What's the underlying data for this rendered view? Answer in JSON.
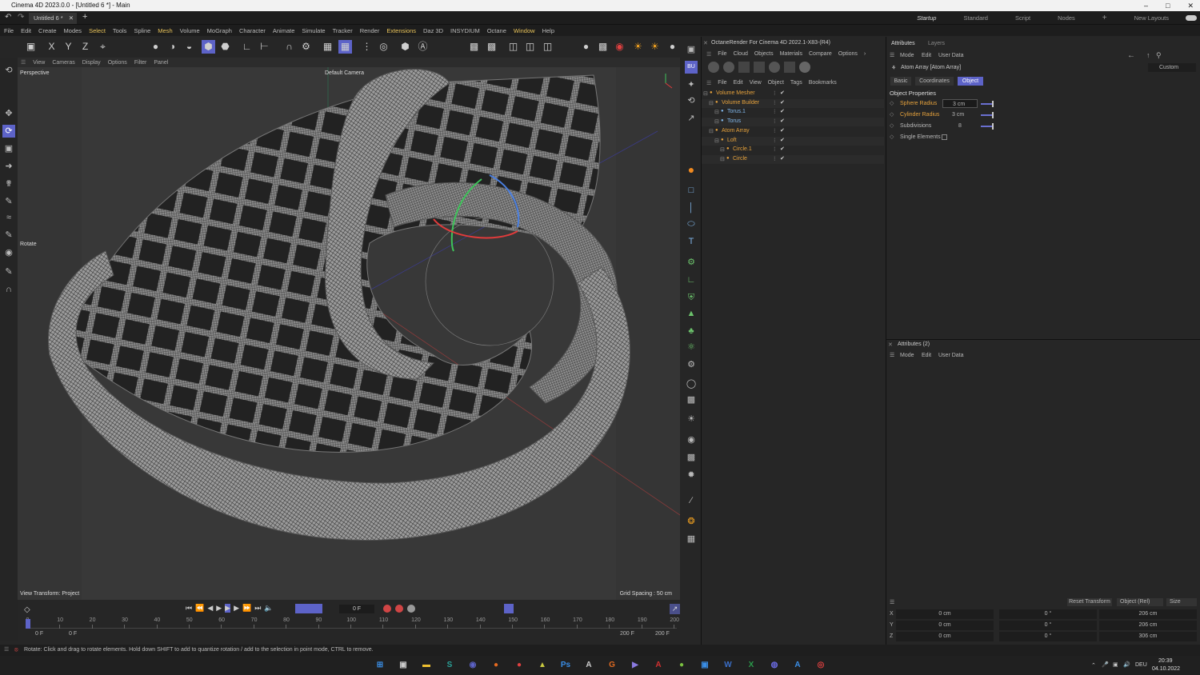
{
  "window": {
    "title": "Cinema 4D 2023.0.0 - [Untitled 6 *] - Main",
    "doc_tab": "Untitled 6 *"
  },
  "layouts": [
    "Startup",
    "Standard",
    "Script",
    "Nodes",
    "+",
    "New Layouts"
  ],
  "menu": [
    "File",
    "Edit",
    "Create",
    "Modes",
    "Select",
    "Tools",
    "Spline",
    "Mesh",
    "Volume",
    "MoGraph",
    "Character",
    "Animate",
    "Simulate",
    "Tracker",
    "Render",
    "Extensions",
    "Daz 3D",
    "INSYDIUM",
    "Octane",
    "Window",
    "Help"
  ],
  "viewport": {
    "menu": [
      "View",
      "Cameras",
      "Display",
      "Options",
      "Filter",
      "Panel"
    ],
    "name": "Perspective",
    "camera": "Default Camera",
    "tool": "Rotate",
    "transform": "View Transform: Project",
    "grid": "Grid Spacing : 50 cm"
  },
  "timeline": {
    "ticks": [
      "0",
      "10",
      "20",
      "30",
      "40",
      "50",
      "60",
      "70",
      "80",
      "90",
      "100",
      "110",
      "120",
      "130",
      "140",
      "150",
      "160",
      "170",
      "180",
      "190",
      "200"
    ],
    "current": "0 F",
    "start": "0 F",
    "start2": "0 F",
    "end": "200 F",
    "end2": "200 F"
  },
  "status": "Rotate: Click and drag to rotate elements. Hold down SHIFT to add to quantize rotation / add to the selection in point mode, CTRL to remove.",
  "octane": {
    "title": "OctaneRender For Cinema 4D 2022.1-X83-(R4)",
    "menu": [
      "File",
      "Cloud",
      "Objects",
      "Materials",
      "Compare",
      "Options"
    ]
  },
  "objects": {
    "menu": [
      "File",
      "Edit",
      "View",
      "Object",
      "Tags",
      "Bookmarks"
    ],
    "tree": [
      {
        "name": "Volume Mesher",
        "indent": 0,
        "color": "#e6a23c"
      },
      {
        "name": "Volume Builder",
        "indent": 1,
        "color": "#e6a23c"
      },
      {
        "name": "Torus.1",
        "indent": 2,
        "color": "#7fb5e8"
      },
      {
        "name": "Torus",
        "indent": 2,
        "color": "#7fb5e8"
      },
      {
        "name": "Atom Array",
        "indent": 1,
        "color": "#e6a23c"
      },
      {
        "name": "Loft",
        "indent": 2,
        "color": "#e6a23c"
      },
      {
        "name": "Circle.1",
        "indent": 3,
        "color": "#e6a23c"
      },
      {
        "name": "Circle",
        "indent": 3,
        "color": "#e6a23c"
      }
    ]
  },
  "attributes": {
    "tabs": [
      "Attributes",
      "Layers"
    ],
    "menu": [
      "Mode",
      "Edit",
      "User Data"
    ],
    "object": "Atom Array [Atom Array]",
    "preset": "Custom",
    "subtabs": [
      "Basic",
      "Coordinates",
      "Object"
    ],
    "section": "Object Properties",
    "props": [
      {
        "label": "Sphere Radius",
        "value": "3 cm",
        "color": "#e6a23c"
      },
      {
        "label": "Cylinder Radius",
        "value": "3 cm",
        "color": "#e6a23c"
      },
      {
        "label": "Subdivisions",
        "value": "8",
        "color": "#b8b8b8"
      },
      {
        "label": "Single Elements",
        "value": "",
        "color": "#b8b8b8"
      }
    ]
  },
  "attributes2": {
    "title": "Attributes (2)",
    "menu": [
      "Mode",
      "Edit",
      "User Data"
    ]
  },
  "coords": {
    "reset": "Reset Transform",
    "mode": "Object (Rel)",
    "size": "Size",
    "rows": [
      {
        "axis": "X",
        "pos": "0 cm",
        "rot": "0 °",
        "size": "206 cm"
      },
      {
        "axis": "Y",
        "pos": "0 cm",
        "rot": "0 °",
        "size": "206 cm"
      },
      {
        "axis": "Z",
        "pos": "0 cm",
        "rot": "0 °",
        "size": "306 cm"
      }
    ]
  },
  "clock": {
    "time": "20:39",
    "date": "04.10.2022",
    "lang": "DEU"
  },
  "colors": {
    "accent": "#5d63c8",
    "highlight": "#e8c35a"
  }
}
